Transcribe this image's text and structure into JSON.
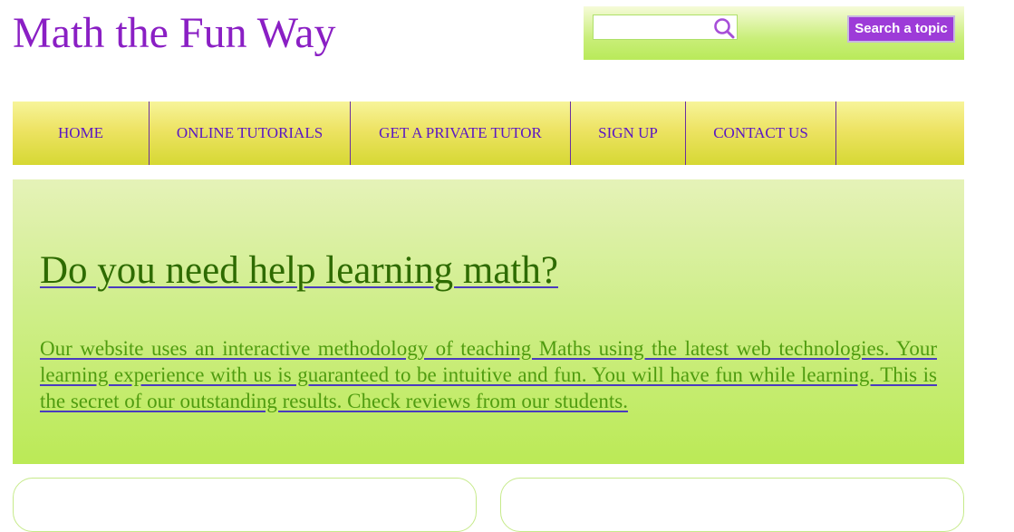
{
  "header": {
    "site_title": "Math the Fun Way"
  },
  "search": {
    "placeholder": "",
    "value": "",
    "button_label": "Search a topic",
    "icon": "search-icon"
  },
  "nav": {
    "items": [
      {
        "label": "HOME"
      },
      {
        "label": "ONLINE TUTORIALS"
      },
      {
        "label": "GET A PRIVATE TUTOR"
      },
      {
        "label": "SIGN UP"
      },
      {
        "label": "CONTACT US"
      }
    ]
  },
  "hero": {
    "heading": "Do you need help learning math?",
    "body": "Our website uses an interactive methodology of teaching Maths using the latest web technologies. Your learning experience with us is guaranteed to be intuitive and fun. You will have fun while learning. This is the secret of our outstanding results. Check reviews from our students."
  },
  "colors": {
    "brand_purple": "#8a1fc4",
    "button_purple": "#9d3bd8",
    "nav_text": "#5a16c4",
    "heading_green": "#2e6b00",
    "body_green": "#4f9c0f",
    "hero_green": "#bbea56",
    "nav_yellow": "#ede363"
  }
}
